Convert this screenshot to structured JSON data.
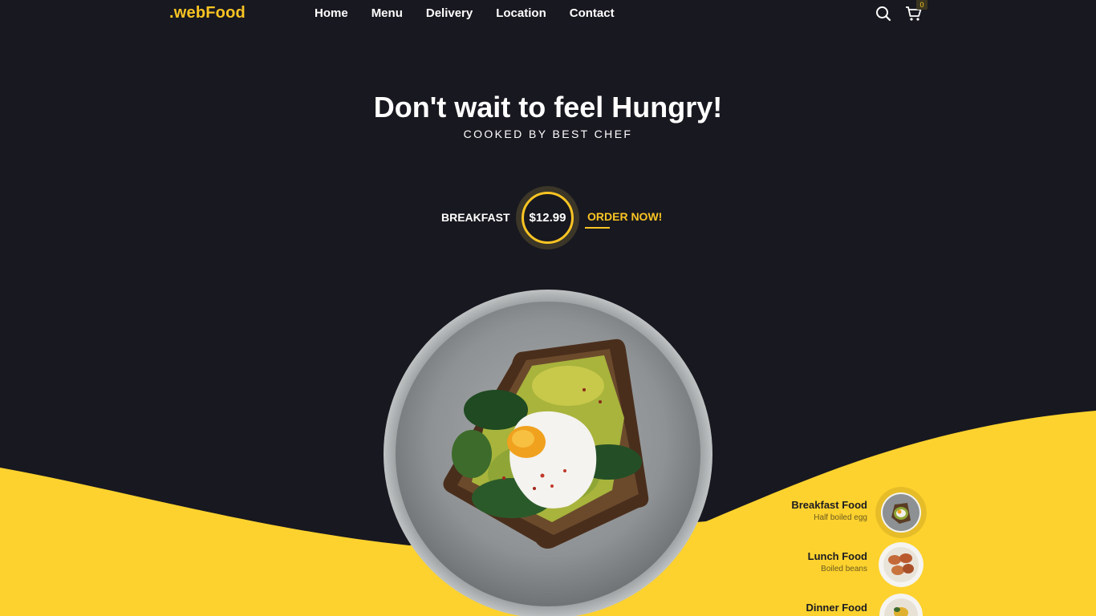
{
  "header": {
    "logo": ".webFood",
    "nav": [
      "Home",
      "Menu",
      "Delivery",
      "Location",
      "Contact"
    ],
    "cart_count": "0",
    "icons": [
      "search-icon",
      "cart-icon"
    ]
  },
  "hero": {
    "title": "Don't wait to feel Hungry!",
    "subtitle": "COOKED BY BEST CHEF"
  },
  "offer": {
    "category": "BREAKFAST",
    "price": "$12.99",
    "cta": "ORDER NOW!"
  },
  "foods": [
    {
      "title": "Breakfast Food",
      "desc": "Half boiled egg",
      "active": true
    },
    {
      "title": "Lunch Food",
      "desc": "Boiled beans",
      "active": false
    },
    {
      "title": "Dinner Food",
      "desc": "",
      "active": false
    }
  ],
  "colors": {
    "background": "#181820",
    "accent": "#f9c423",
    "wave": "#fdd22e"
  }
}
